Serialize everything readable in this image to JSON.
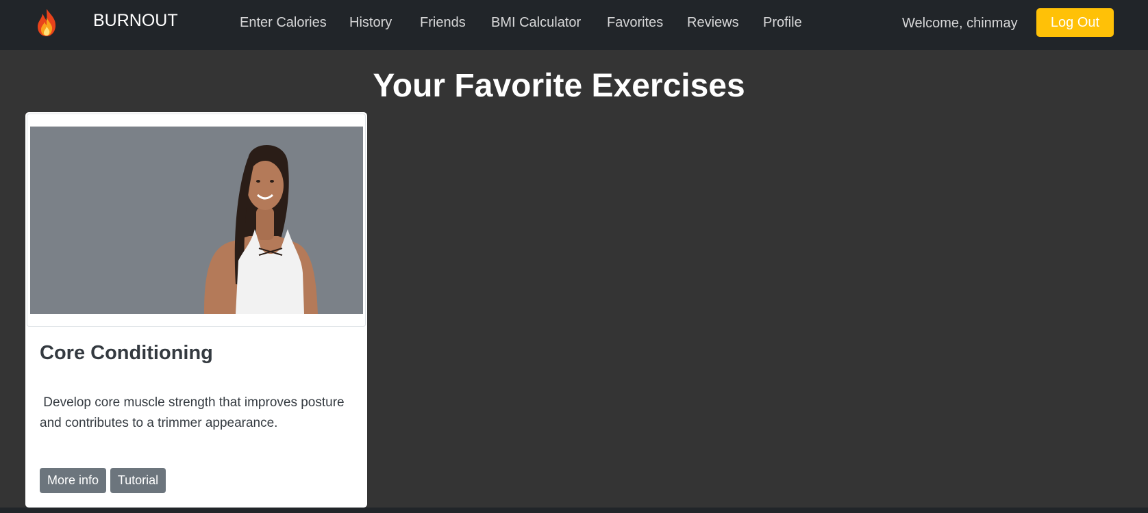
{
  "navbar": {
    "brand": "BURNOUT",
    "logo_icon": "flame-icon",
    "links": [
      {
        "label": "Enter Calories"
      },
      {
        "label": "History"
      },
      {
        "label": "Friends"
      },
      {
        "label": "BMI Calculator"
      },
      {
        "label": "Favorites"
      },
      {
        "label": "Reviews"
      },
      {
        "label": "Profile"
      }
    ],
    "welcome_text": "Welcome, chinmay",
    "logout_label": "Log Out"
  },
  "page": {
    "title": "Your Favorite Exercises"
  },
  "favorites": [
    {
      "title": "Core Conditioning",
      "description": " Develop core muscle strength that improves posture and contributes to a trimmer appearance.",
      "more_info_label": "More info",
      "tutorial_label": "Tutorial",
      "image_icon": "exercise-photo"
    }
  ],
  "colors": {
    "navbar_bg": "#212529",
    "page_bg": "#343434",
    "accent_button": "#ffc107",
    "secondary_button": "#6c757d"
  }
}
